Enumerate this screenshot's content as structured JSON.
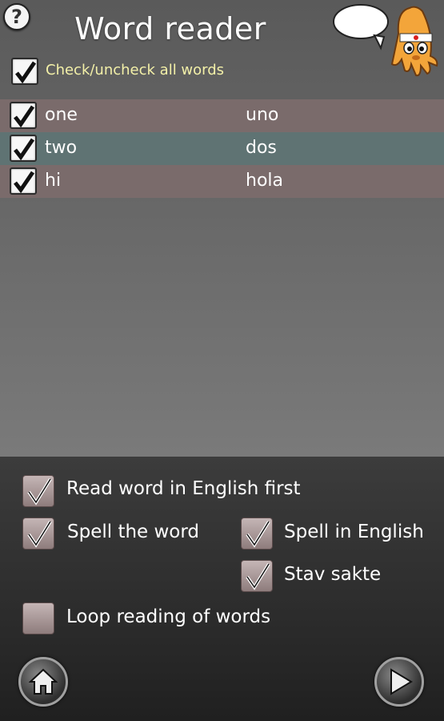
{
  "header": {
    "help_icon": "?",
    "title": "Word reader"
  },
  "check_all": {
    "checked": true,
    "label": "Check/uncheck all words"
  },
  "words": [
    {
      "checked": true,
      "word": "one",
      "translation": "uno",
      "row_color": "#7a6b6b"
    },
    {
      "checked": true,
      "word": "two",
      "translation": "dos",
      "row_color": "#5f7373"
    },
    {
      "checked": true,
      "word": "hi",
      "translation": "hola",
      "row_color": "#7a6b6b"
    }
  ],
  "options": {
    "read_english_first": {
      "label": "Read word in English first",
      "checked": true
    },
    "spell_word": {
      "label": "Spell the word",
      "checked": true
    },
    "spell_english": {
      "label": "Spell in English",
      "checked": true
    },
    "stav_sakte": {
      "label": "Stav sakte",
      "checked": true
    },
    "loop_reading": {
      "label": "Loop reading of words",
      "checked": false
    }
  },
  "footer": {
    "home_icon": "home-icon",
    "play_icon": "play-icon"
  }
}
